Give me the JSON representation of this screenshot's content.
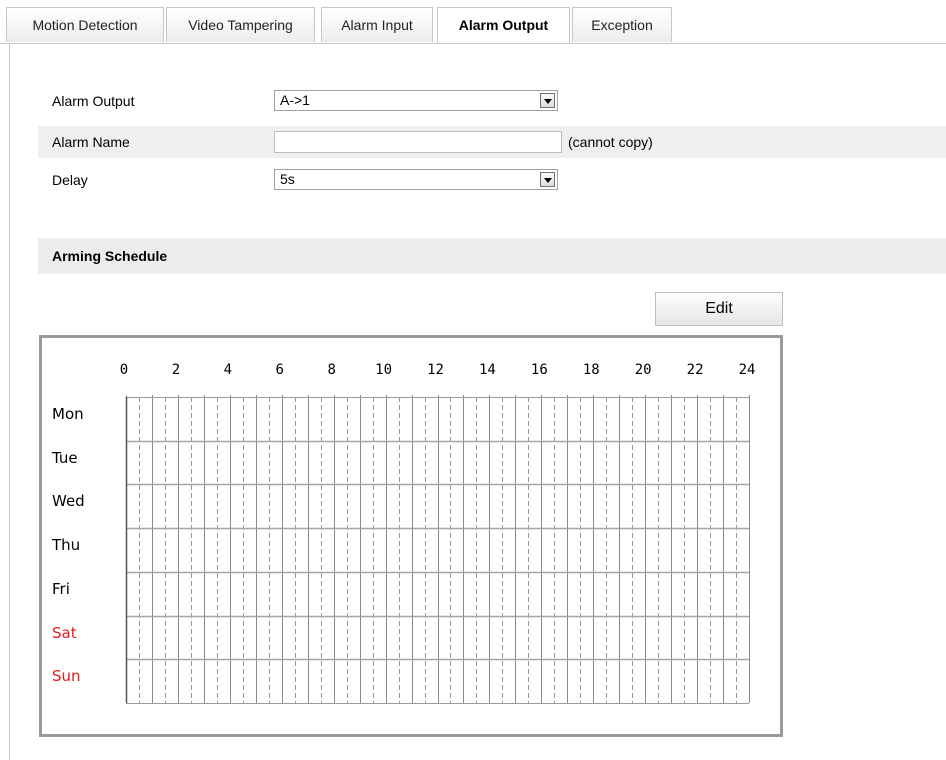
{
  "tabs": [
    {
      "label": "Motion Detection"
    },
    {
      "label": "Video Tampering"
    },
    {
      "label": "Alarm Input"
    },
    {
      "label": "Alarm Output"
    },
    {
      "label": "Exception"
    }
  ],
  "active_tab": "Alarm Output",
  "form": {
    "alarm_output": {
      "label": "Alarm Output",
      "value": "A->1"
    },
    "alarm_name": {
      "label": "Alarm Name",
      "value": "",
      "note": "(cannot copy)"
    },
    "delay": {
      "label": "Delay",
      "value": "5s"
    }
  },
  "schedule": {
    "title": "Arming Schedule",
    "edit_label": "Edit",
    "hours": [
      "0",
      "2",
      "4",
      "6",
      "8",
      "10",
      "12",
      "14",
      "16",
      "18",
      "20",
      "22",
      "24"
    ],
    "days": [
      {
        "label": "Mon",
        "weekend": false
      },
      {
        "label": "Tue",
        "weekend": false
      },
      {
        "label": "Wed",
        "weekend": false
      },
      {
        "label": "Thu",
        "weekend": false
      },
      {
        "label": "Fri",
        "weekend": false
      },
      {
        "label": "Sat",
        "weekend": true
      },
      {
        "label": "Sun",
        "weekend": true
      }
    ],
    "weekend_color": "#e8191f"
  }
}
